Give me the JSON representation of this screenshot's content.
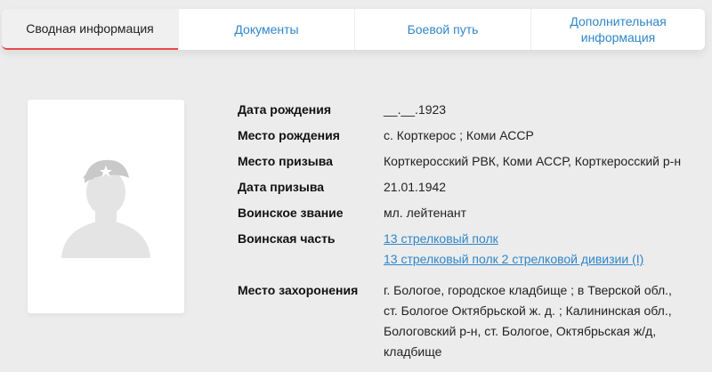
{
  "tabs": [
    {
      "label": "Сводная информация",
      "active": true
    },
    {
      "label": "Документы",
      "active": false
    },
    {
      "label": "Боевой путь",
      "active": false
    },
    {
      "label": "Дополнительная информация",
      "active": false
    }
  ],
  "photo": {
    "icon": "soldier-silhouette-icon"
  },
  "info": {
    "birth_date": {
      "label": "Дата рождения",
      "value": "__.__.1923"
    },
    "birth_place": {
      "label": "Место рождения",
      "value": "с. Корткерос ; Коми АССР"
    },
    "draft_place": {
      "label": "Место призыва",
      "value": "Корткеросский РВК, Коми АССР, Корткеросский р-н"
    },
    "draft_date": {
      "label": "Дата призыва",
      "value": "21.01.1942"
    },
    "rank": {
      "label": "Воинское звание",
      "value": "мл. лейтенант"
    },
    "unit": {
      "label": "Воинская часть",
      "links": [
        "13 стрелковый полк",
        "13 стрелковый полк 2 стрелковой дивизии (I)"
      ]
    },
    "burial": {
      "label": "Место захоронения",
      "value": "г. Бологое, городское кладбище ; в Тверской обл., ст. Бологое Октябрьской ж. д. ; Калининская обл., Бологовский р-н, ст. Бологое, Октябрьская ж/д, кладбище"
    }
  },
  "colors": {
    "accent": "#e84a4a",
    "link": "#2f86c9",
    "background": "#ececec"
  }
}
